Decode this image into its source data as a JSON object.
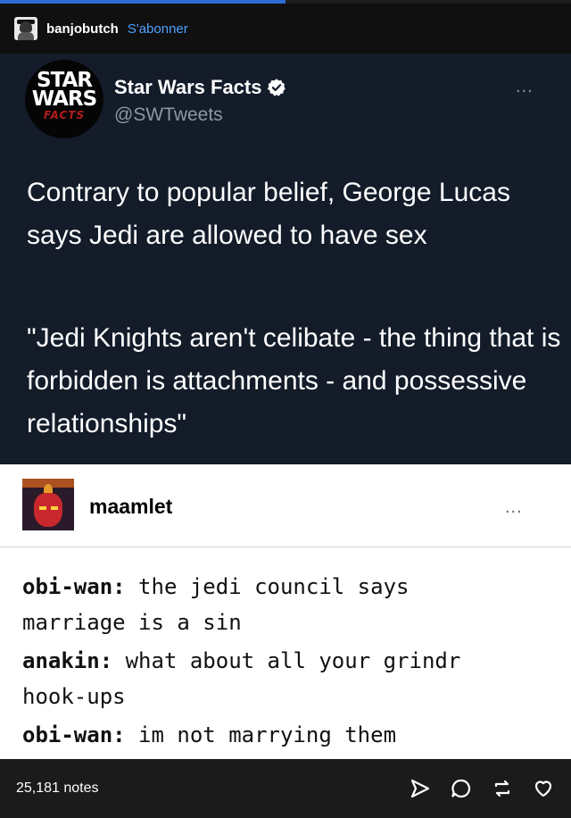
{
  "post": {
    "author": "banjobutch",
    "follow_label": "S'abonner",
    "notes": "25,181 notes"
  },
  "tweet": {
    "logo_lines": [
      "STAR",
      "WARS",
      "FACTS"
    ],
    "name": "Star Wars Facts",
    "handle": "@SWTweets",
    "more": "...",
    "paragraph1": "Contrary to popular belief, George Lucas says Jedi are allowed to have sex",
    "paragraph2": "\"Jedi Knights aren't celibate - the thing that is forbidden is attachments - and possessive relationships\""
  },
  "reblog": {
    "username": "maamlet",
    "more": "...",
    "lines": [
      {
        "speaker": "obi-wan:",
        "text": " the jedi council says"
      },
      {
        "speaker": "",
        "text": "marriage is a sin"
      },
      {
        "speaker": "anakin:",
        "text": " what about all your grindr"
      },
      {
        "speaker": "",
        "text": "hook-ups"
      },
      {
        "speaker": "obi-wan:",
        "text": " im not marrying them"
      }
    ]
  },
  "icons": [
    "send-icon",
    "reply-icon",
    "reblog-icon",
    "like-icon"
  ],
  "colors": {
    "tweet_bg": "#141c2a",
    "follow_link": "#4fa1ff",
    "verified": "#ffffff",
    "logo_red": "#b31c1c"
  }
}
